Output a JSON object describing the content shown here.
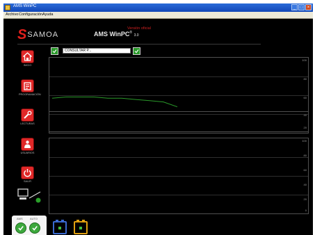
{
  "window": {
    "title": "AMS WinPC"
  },
  "menu": [
    "Archivo",
    "Configuración",
    "Ayuda"
  ],
  "header": {
    "brand_mark": "S",
    "brand_text": "SAMOA",
    "red_tag": "Versión oficial",
    "app_title": "AMS WinPC",
    "app_title_sup": "®",
    "app_version": "3.0"
  },
  "sidebar": {
    "items": [
      {
        "label": "INICIO",
        "icon": "home-icon"
      },
      {
        "label": "PROGRAMACIÓN",
        "icon": "program-icon"
      },
      {
        "label": "LECTURAS",
        "icon": "wrench-icon"
      },
      {
        "label": "USUARIOS",
        "icon": "users-icon"
      },
      {
        "label": "SALIR",
        "icon": "exit-icon"
      }
    ],
    "connection_icon": "computer-connection-icon"
  },
  "toolbar": {
    "device_field": "CONSULTAR P..."
  },
  "charts": {
    "plot1_ticks": [
      "100",
      "80",
      "60"
    ],
    "plot2_ticks": [
      "40",
      "20"
    ],
    "plot3_ticks": [
      "100",
      "80",
      "60",
      "40",
      "20",
      "0"
    ]
  },
  "chart_data": {
    "type": "line",
    "series": [
      {
        "values": [
          67,
          68,
          68,
          68,
          67,
          67,
          66,
          65,
          64,
          60
        ]
      }
    ]
  },
  "tabs": {
    "labels": [
      "AMS",
      "AUTO"
    ],
    "icons": [
      "check-icon",
      "check-icon",
      "battery-blue-icon",
      "battery-yellow-icon"
    ]
  },
  "colors": {
    "accent": "#e02828",
    "background": "#000000",
    "series": "#2a9a2a",
    "battery_blue": "#3a6ad0",
    "battery_yellow": "#e0a010"
  }
}
